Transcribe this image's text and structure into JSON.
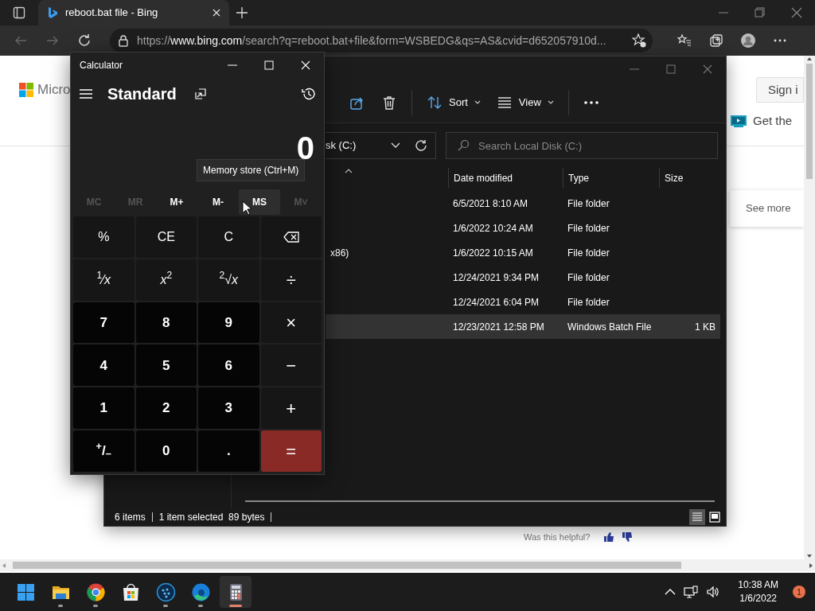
{
  "browser": {
    "tabs": [
      {
        "title": "reboot.bat file - Bing",
        "selected": true
      }
    ],
    "url": "https://**www.bing.com**/search?q=reboot.bat+file&form=WSBEDG&qs=AS&cvid=d652057910d..."
  },
  "page": {
    "logo_text": "Micro",
    "sign_in": "Sign i",
    "promo": "Get the",
    "see_more": "See more",
    "feedback": "Was this helpful?"
  },
  "explorer": {
    "toolbar": [
      {
        "kind": "share"
      },
      {
        "kind": "delete"
      },
      {
        "kind": "separator"
      },
      {
        "kind": "sort",
        "label": "Sort"
      },
      {
        "kind": "view",
        "label": "View"
      },
      {
        "kind": "separator"
      },
      {
        "kind": "more"
      }
    ],
    "address": "sk (C:)",
    "search": {
      "placeholder": "Search Local Disk (C:)"
    },
    "columns": [
      "Date modified",
      "Type",
      "Size"
    ],
    "rows": [
      {
        "date": "6/5/2021 8:10 AM",
        "type": "File folder",
        "selected": false
      },
      {
        "date": "1/6/2022 10:24 AM",
        "type": "File folder",
        "selected": false
      },
      {
        "name": "x86)",
        "date": "1/6/2022 10:15 AM",
        "type": "File folder",
        "selected": false
      },
      {
        "date": "12/24/2021 9:34 PM",
        "type": "File folder",
        "selected": false
      },
      {
        "date": "12/24/2021 6:04 PM",
        "type": "File folder",
        "selected": false
      },
      {
        "date": "12/23/2021 12:58 PM",
        "type": "Windows Batch File",
        "size": "1 KB",
        "selected": true
      }
    ],
    "status": {
      "count": "6 items",
      "selection": "1 item selected  89 bytes"
    },
    "views": [
      {
        "kind": "details",
        "selected": true
      },
      {
        "kind": "tiles",
        "selected": false
      }
    ]
  },
  "calculator": {
    "title": "Calculator",
    "mode": "Standard",
    "display": "0",
    "tooltip": "Memory store (Ctrl+M)",
    "memory": [
      {
        "label": "MC",
        "disabled": true,
        "hovered": false
      },
      {
        "label": "MR",
        "disabled": true,
        "hovered": false
      },
      {
        "label": "M+",
        "disabled": false,
        "hovered": false
      },
      {
        "label": "M-",
        "disabled": false,
        "hovered": false
      },
      {
        "label": "MS",
        "disabled": false,
        "hovered": true
      },
      {
        "label": "M˅",
        "disabled": true,
        "hovered": false
      }
    ],
    "keys": [
      {
        "label": "%",
        "kind": "func"
      },
      {
        "label": "CE",
        "kind": "func"
      },
      {
        "label": "C",
        "kind": "func"
      },
      {
        "kind": "backspace"
      },
      {
        "label": "$^{1}$⁄*x*",
        "kind": "func"
      },
      {
        "label": "*x*$^{2}$",
        "kind": "func"
      },
      {
        "label": "$^{2}$√*x*",
        "kind": "func"
      },
      {
        "label": "÷",
        "kind": "op"
      },
      {
        "label": "7",
        "kind": "digit"
      },
      {
        "label": "8",
        "kind": "digit"
      },
      {
        "label": "9",
        "kind": "digit"
      },
      {
        "label": "×",
        "kind": "op"
      },
      {
        "label": "4",
        "kind": "digit"
      },
      {
        "label": "5",
        "kind": "digit"
      },
      {
        "label": "6",
        "kind": "digit"
      },
      {
        "label": "−",
        "kind": "op"
      },
      {
        "label": "1",
        "kind": "digit"
      },
      {
        "label": "2",
        "kind": "digit"
      },
      {
        "label": "3",
        "kind": "digit"
      },
      {
        "label": "+",
        "kind": "op"
      },
      {
        "label": "$^{+}$/$_{–}$",
        "kind": "digit"
      },
      {
        "label": "0",
        "kind": "digit"
      },
      {
        "label": ".",
        "kind": "digit"
      },
      {
        "label": "=",
        "kind": "equals"
      }
    ]
  },
  "taskbar": {
    "apps": [
      {
        "kind": "start",
        "running": false,
        "selected": false
      },
      {
        "kind": "files",
        "running": true,
        "selected": false
      },
      {
        "kind": "chrome",
        "running": true,
        "selected": false
      },
      {
        "kind": "store",
        "running": false,
        "selected": false
      },
      {
        "kind": "app",
        "running": true,
        "selected": false
      },
      {
        "kind": "edge",
        "running": true,
        "selected": false
      },
      {
        "kind": "calculator",
        "running": true,
        "selected": true
      }
    ],
    "time": "10:38 AM",
    "date": "1/6/2022",
    "notifications": "1"
  }
}
